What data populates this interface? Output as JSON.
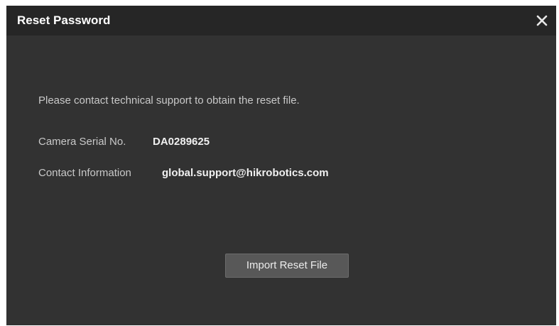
{
  "dialog": {
    "title": "Reset Password",
    "close_icon": "close-icon"
  },
  "content": {
    "message": "Please contact technical support to obtain the reset file.",
    "serial_label": "Camera Serial No.",
    "serial_value": "DA0289625",
    "contact_label": "Contact Information",
    "contact_value": "global.support@hikrobotics.com"
  },
  "actions": {
    "import_label": "Import Reset File"
  },
  "colors": {
    "dialog_bg": "#323232",
    "titlebar_bg": "#262626",
    "button_bg": "#585858",
    "text": "#c9c9c9",
    "value_text": "#f0f0f0"
  }
}
